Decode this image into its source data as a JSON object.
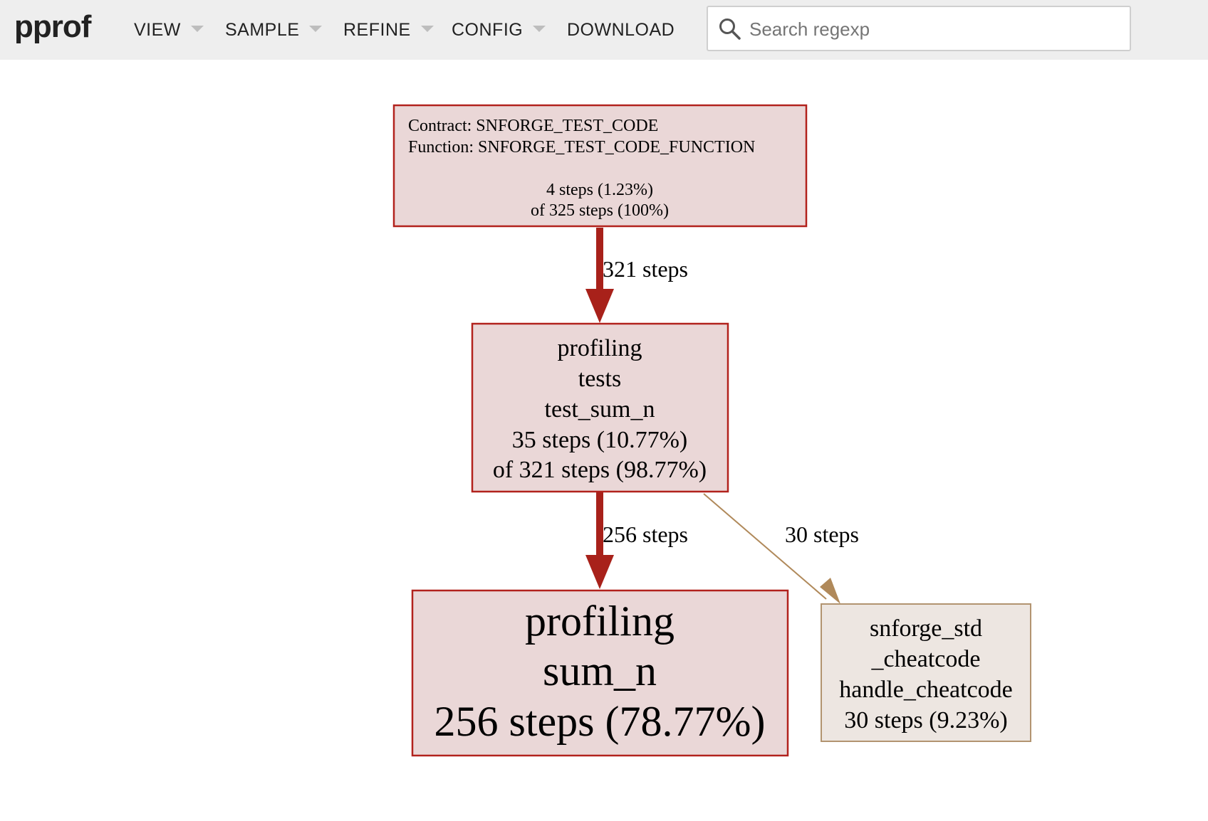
{
  "app": {
    "logo": "pprof"
  },
  "menu": {
    "view": "VIEW",
    "sample": "SAMPLE",
    "refine": "REFINE",
    "config": "CONFIG",
    "download": "DOWNLOAD"
  },
  "search": {
    "placeholder": "Search regexp",
    "value": ""
  },
  "colors": {
    "hot_edge": "#a8211a",
    "cool_edge": "#b0895a",
    "hot_node_fill": "#ead7d7",
    "hot_node_border": "#b2221d",
    "cool_node_fill": "#ede6e1",
    "cool_node_border": "#b29470"
  },
  "graph": {
    "nodes": {
      "root": {
        "line1": "Contract: SNFORGE_TEST_CODE",
        "line2": "Function: SNFORGE_TEST_CODE_FUNCTION",
        "flat": "4 steps (1.23%)",
        "cum": "of 325 steps (100%)"
      },
      "test_sum_n": {
        "line1": "profiling",
        "line2": "tests",
        "line3": "test_sum_n",
        "flat": "35 steps (10.77%)",
        "cum": "of 321 steps (98.77%)"
      },
      "sum_n": {
        "line1": "profiling",
        "line2": "sum_n",
        "flat": "256 steps (78.77%)"
      },
      "handle_cheatcode": {
        "line1": "snforge_std",
        "line2": "_cheatcode",
        "line3": "handle_cheatcode",
        "flat": "30 steps (9.23%)"
      }
    },
    "edges": {
      "root_to_test": "321 steps",
      "test_to_sum": "256 steps",
      "test_to_cheatcode": "30 steps"
    }
  }
}
